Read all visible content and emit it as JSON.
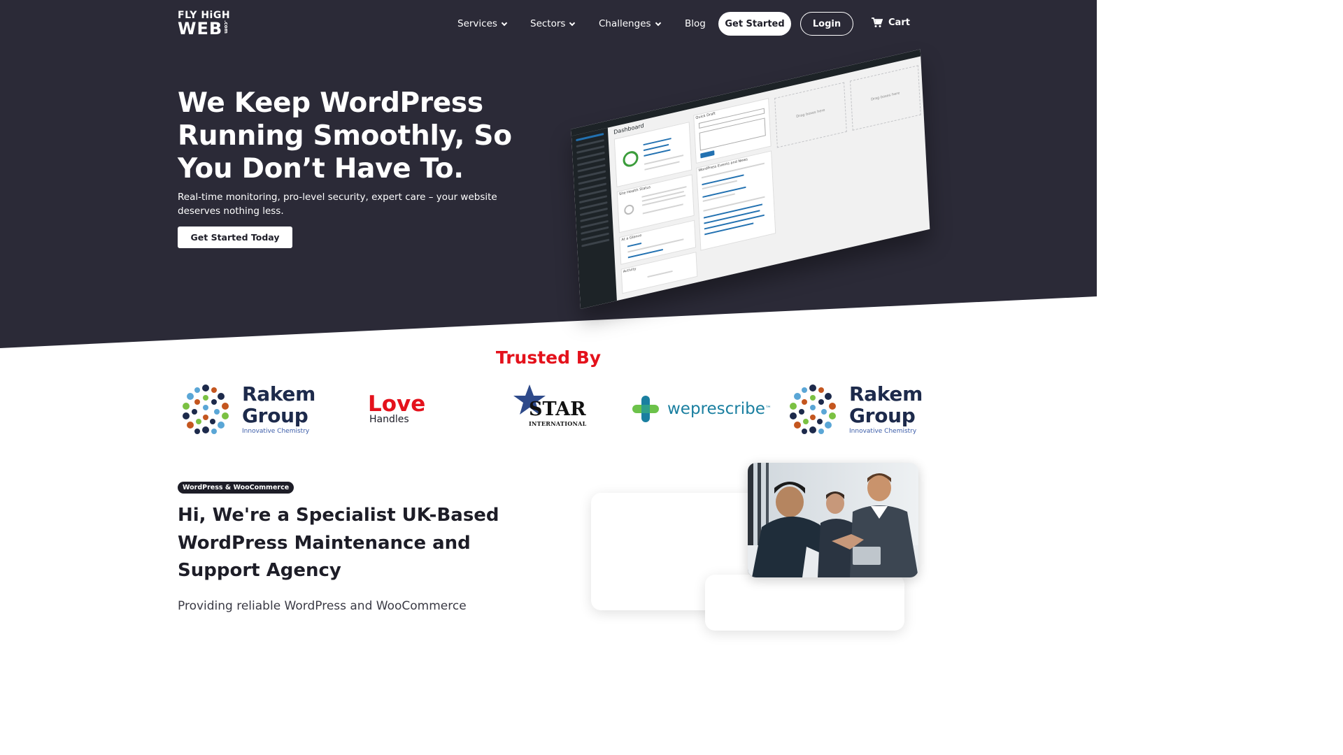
{
  "brand": {
    "line1": "FLY HiGH",
    "line2": "WEB",
    "line3": ".com"
  },
  "nav": {
    "items": [
      {
        "label": "Services",
        "dropdown": true
      },
      {
        "label": "Sectors",
        "dropdown": true
      },
      {
        "label": "Challenges",
        "dropdown": true
      },
      {
        "label": "Blog",
        "dropdown": false
      }
    ],
    "get_started": "Get Started",
    "login": "Login",
    "cart": "Cart"
  },
  "hero": {
    "title": "We Keep WordPress Running Smoothly, So You Don’t Have To.",
    "subtitle": "Real-time monitoring, pro-level security, expert care – your website deserves nothing less.",
    "cta": "Get Started Today",
    "dashboard_title": "Dashboard",
    "dashboard_panels": [
      "Quick Draft",
      "Site Health Status",
      "At a Glance",
      "Activity",
      "WordPress Events and News"
    ],
    "drag_box_label": "Drag boxes here"
  },
  "trusted": {
    "heading": "Trusted By",
    "logos": [
      {
        "name": "Rakem",
        "second": "Group",
        "tagline": "Innovative Chemistry"
      },
      {
        "name": "Love",
        "second": "Handles"
      },
      {
        "name": "STAR",
        "second": "INTERNATIONAL"
      },
      {
        "name": "weprescribe",
        "mark": "™"
      },
      {
        "name": "Rakem",
        "second": "Group",
        "tagline": "Innovative Chemistry"
      }
    ]
  },
  "about": {
    "badge": "WordPress & WooCommerce",
    "heading": "Hi, We're a Specialist UK-Based WordPress Maintenance and Support Agency",
    "text": "Providing reliable WordPress and WooCommerce"
  },
  "colors": {
    "dark": "#2b2a37",
    "accent_red": "#e4121c",
    "rakem_navy": "#1d2a4b",
    "weprescribe_blue": "#1a7fa0",
    "weprescribe_green": "#6cc24a"
  }
}
